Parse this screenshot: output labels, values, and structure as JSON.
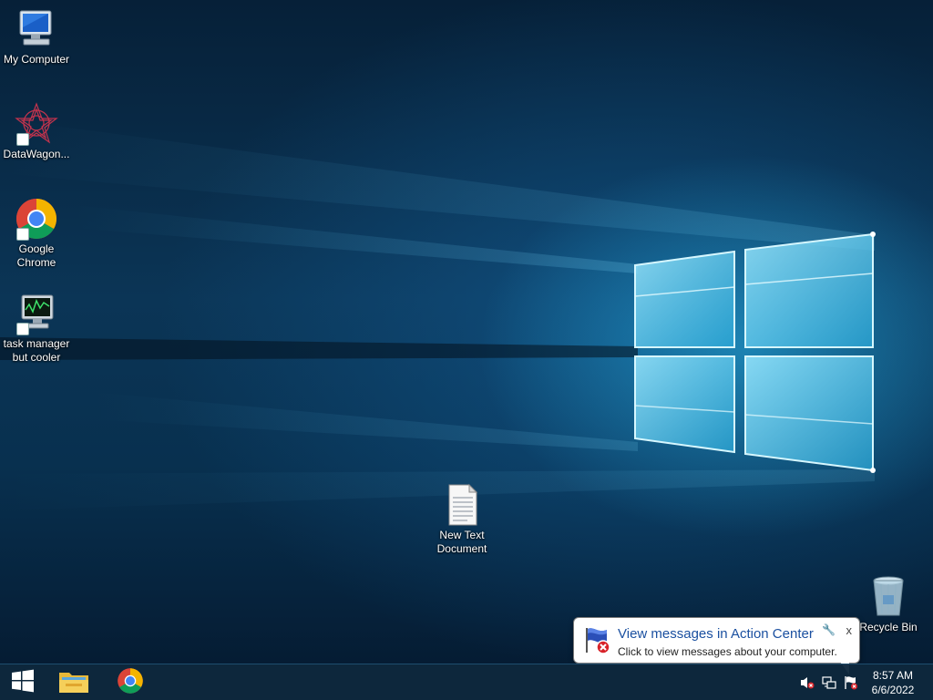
{
  "desktop_icons": [
    {
      "label": "My Computer",
      "icon": "computer-icon"
    },
    {
      "label": "DataWagon...",
      "icon": "datawagon-icon"
    },
    {
      "label_line1": "Google",
      "label_line2": "Chrome",
      "icon": "chrome-icon"
    },
    {
      "label_line1": "task manager",
      "label_line2": "but cooler",
      "icon": "monitor-icon"
    },
    {
      "label_line1": "New Text",
      "label_line2": "Document",
      "icon": "text-document-icon"
    },
    {
      "label": "Recycle Bin",
      "icon": "recycle-bin-icon"
    }
  ],
  "taskbar": {
    "start": "windows-logo-icon",
    "pinned": [
      "file-explorer-icon",
      "chrome-icon"
    ],
    "clock": {
      "time": "8:57 AM",
      "date": "6/6/2022"
    },
    "tray": [
      "volume-muted-icon",
      "network-icon",
      "action-center-flag-icon"
    ]
  },
  "balloon": {
    "title": "View messages in Action Center",
    "text": "Click to view messages about your computer.",
    "close": "x",
    "icon": "action-center-flag-icon"
  },
  "colors": {
    "taskbar": "#0e283c",
    "balloon_title": "#1b50a0",
    "accent_glow": "#5fd6ff"
  }
}
